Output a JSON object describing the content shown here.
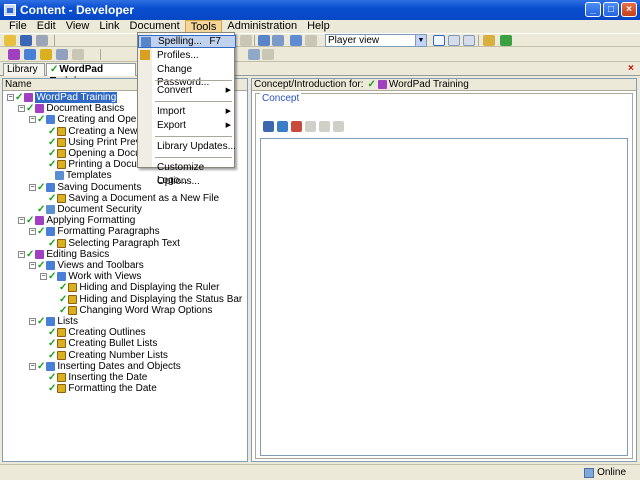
{
  "window": {
    "title": "Content - Developer"
  },
  "menubar": {
    "items": [
      "File",
      "Edit",
      "View",
      "Link",
      "Document",
      "Tools",
      "Administration",
      "Help"
    ],
    "active": "Tools"
  },
  "toolbar": {
    "view_combo": "Player view"
  },
  "tabs": {
    "library": "Library",
    "course": "WordPad Training"
  },
  "left_pane": {
    "header": "Name"
  },
  "tree": [
    {
      "label": "WordPad Training",
      "depth": 0,
      "type": "course",
      "expand": "-",
      "selected": true
    },
    {
      "label": "Document Basics",
      "depth": 1,
      "type": "course",
      "expand": "-"
    },
    {
      "label": "Creating and Opening Documents",
      "depth": 2,
      "type": "mod",
      "expand": "-"
    },
    {
      "label": "Creating a New Document",
      "depth": 3,
      "type": "topic"
    },
    {
      "label": "Using Print Preview",
      "depth": 3,
      "type": "topic"
    },
    {
      "label": "Opening a Document",
      "depth": 3,
      "type": "topic"
    },
    {
      "label": "Printing a Document",
      "depth": 3,
      "type": "topic"
    },
    {
      "label": "Templates",
      "depth": 3,
      "type": "doc",
      "nocheck": true
    },
    {
      "label": "Saving Documents",
      "depth": 2,
      "type": "mod",
      "expand": "-"
    },
    {
      "label": "Saving a Document as a New File",
      "depth": 3,
      "type": "topic"
    },
    {
      "label": "Document Security",
      "depth": 2,
      "type": "doc"
    },
    {
      "label": "Applying Formatting",
      "depth": 1,
      "type": "course",
      "expand": "-"
    },
    {
      "label": "Formatting Paragraphs",
      "depth": 2,
      "type": "mod",
      "expand": "-"
    },
    {
      "label": "Selecting Paragraph Text",
      "depth": 3,
      "type": "topic"
    },
    {
      "label": "Editing Basics",
      "depth": 1,
      "type": "course",
      "expand": "-"
    },
    {
      "label": "Views and Toolbars",
      "depth": 2,
      "type": "mod",
      "expand": "-"
    },
    {
      "label": "Work with Views",
      "depth": 3,
      "type": "mod",
      "expand": "-"
    },
    {
      "label": "Hiding and Displaying the Ruler",
      "depth": 4,
      "type": "topic"
    },
    {
      "label": "Hiding and Displaying the Status Bar",
      "depth": 4,
      "type": "topic"
    },
    {
      "label": "Changing Word Wrap Options",
      "depth": 4,
      "type": "topic"
    },
    {
      "label": "Lists",
      "depth": 2,
      "type": "mod",
      "expand": "-"
    },
    {
      "label": "Creating Outlines",
      "depth": 3,
      "type": "topic"
    },
    {
      "label": "Creating Bullet Lists",
      "depth": 3,
      "type": "topic"
    },
    {
      "label": "Creating Number Lists",
      "depth": 3,
      "type": "topic"
    },
    {
      "label": "Inserting Dates and Objects",
      "depth": 2,
      "type": "mod",
      "expand": "-"
    },
    {
      "label": "Inserting the Date",
      "depth": 3,
      "type": "topic"
    },
    {
      "label": "Formatting the Date",
      "depth": 3,
      "type": "topic"
    }
  ],
  "right_pane": {
    "header_prefix": "Concept/Introduction for:",
    "header_item": "WordPad Training",
    "concept_label": "Concept"
  },
  "tools_menu": [
    {
      "label": "Spelling...",
      "shortcut": "F7",
      "icon": "spellcheck-icon",
      "hover": true
    },
    {
      "label": "Profiles...",
      "icon": "profiles-icon"
    },
    {
      "label": "Change Password..."
    },
    {
      "sep": true
    },
    {
      "label": "Convert",
      "submenu": true
    },
    {
      "sep": true
    },
    {
      "label": "Import",
      "submenu": true
    },
    {
      "label": "Export",
      "submenu": true
    },
    {
      "sep": true
    },
    {
      "label": "Library Updates..."
    },
    {
      "sep": true
    },
    {
      "label": "Customize Logo..."
    },
    {
      "label": "Options..."
    }
  ],
  "status": {
    "online": "Online"
  }
}
